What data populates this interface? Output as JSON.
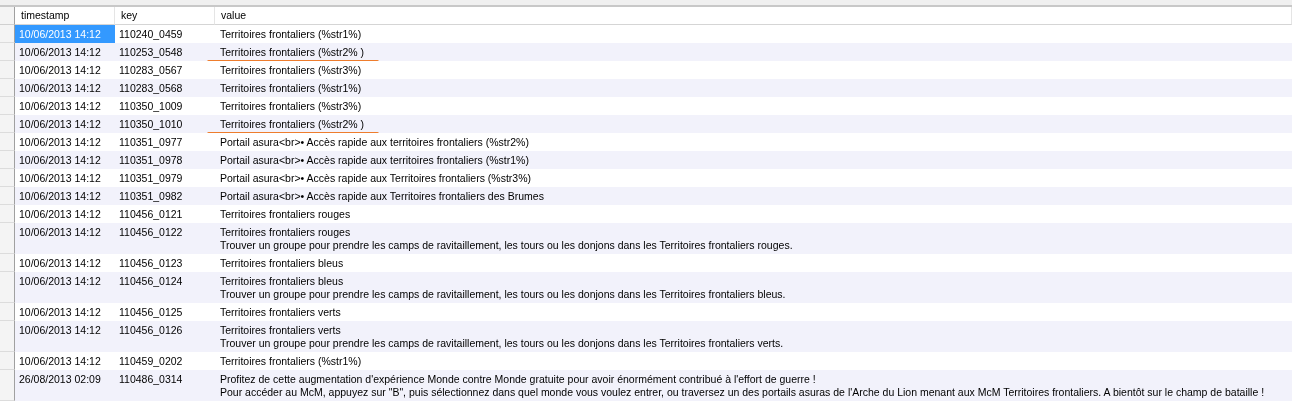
{
  "table": {
    "columns": [
      "timestamp",
      "key",
      "value"
    ],
    "rows": [
      {
        "timestamp": "10/06/2013 14:12",
        "key": "110240_0459",
        "value": [
          "Territoires frontaliers (%str1%)"
        ],
        "selected": true,
        "marked": false
      },
      {
        "timestamp": "10/06/2013 14:12",
        "key": "110253_0548",
        "value": [
          "Territoires frontaliers (%str2% )"
        ],
        "selected": false,
        "marked": true
      },
      {
        "timestamp": "10/06/2013 14:12",
        "key": "110283_0567",
        "value": [
          "Territoires frontaliers (%str3%)"
        ],
        "selected": false,
        "marked": false
      },
      {
        "timestamp": "10/06/2013 14:12",
        "key": "110283_0568",
        "value": [
          "Territoires frontaliers (%str1%)"
        ],
        "selected": false,
        "marked": false
      },
      {
        "timestamp": "10/06/2013 14:12",
        "key": "110350_1009",
        "value": [
          "Territoires frontaliers (%str3%)"
        ],
        "selected": false,
        "marked": false
      },
      {
        "timestamp": "10/06/2013 14:12",
        "key": "110350_1010",
        "value": [
          "Territoires frontaliers (%str2% )"
        ],
        "selected": false,
        "marked": true
      },
      {
        "timestamp": "10/06/2013 14:12",
        "key": "110351_0977",
        "value": [
          "Portail asura<br>• Accès rapide aux territoires frontaliers (%str2%)"
        ],
        "selected": false,
        "marked": false
      },
      {
        "timestamp": "10/06/2013 14:12",
        "key": "110351_0978",
        "value": [
          "Portail asura<br>• Accès rapide aux territoires frontaliers (%str1%)"
        ],
        "selected": false,
        "marked": false
      },
      {
        "timestamp": "10/06/2013 14:12",
        "key": "110351_0979",
        "value": [
          "Portail asura<br>• Accès rapide aux Territoires frontaliers (%str3%)"
        ],
        "selected": false,
        "marked": false
      },
      {
        "timestamp": "10/06/2013 14:12",
        "key": "110351_0982",
        "value": [
          "Portail asura<br>• Accès rapide aux Territoires frontaliers des Brumes"
        ],
        "selected": false,
        "marked": false
      },
      {
        "timestamp": "10/06/2013 14:12",
        "key": "110456_0121",
        "value": [
          "Territoires frontaliers rouges"
        ],
        "selected": false,
        "marked": false
      },
      {
        "timestamp": "10/06/2013 14:12",
        "key": "110456_0122",
        "value": [
          "Territoires frontaliers rouges",
          "Trouver un groupe pour prendre les camps de ravitaillement, les tours ou les donjons dans les Territoires frontaliers rouges."
        ],
        "selected": false,
        "marked": false
      },
      {
        "timestamp": "10/06/2013 14:12",
        "key": "110456_0123",
        "value": [
          "Territoires frontaliers bleus"
        ],
        "selected": false,
        "marked": false
      },
      {
        "timestamp": "10/06/2013 14:12",
        "key": "110456_0124",
        "value": [
          "Territoires frontaliers bleus",
          "Trouver un groupe pour prendre les camps de ravitaillement, les tours ou les donjons dans les Territoires frontaliers bleus."
        ],
        "selected": false,
        "marked": false
      },
      {
        "timestamp": "10/06/2013 14:12",
        "key": "110456_0125",
        "value": [
          "Territoires frontaliers verts"
        ],
        "selected": false,
        "marked": false
      },
      {
        "timestamp": "10/06/2013 14:12",
        "key": "110456_0126",
        "value": [
          "Territoires frontaliers verts",
          "Trouver un groupe pour prendre les camps de ravitaillement, les tours ou les donjons dans les Territoires frontaliers verts."
        ],
        "selected": false,
        "marked": false
      },
      {
        "timestamp": "10/06/2013 14:12",
        "key": "110459_0202",
        "value": [
          "Territoires frontaliers (%str1%)"
        ],
        "selected": false,
        "marked": false
      },
      {
        "timestamp": "26/08/2013 02:09",
        "key": "110486_0314",
        "value": [
          "Profitez de cette augmentation d'expérience Monde contre Monde gratuite pour avoir énormément contribué à l'effort de guerre !",
          "Pour accéder au McM, appuyez sur \"B\", puis sélectionnez dans quel monde vous voulez entrer, ou traversez un des portails asuras de l'Arche du Lion menant aux McM Territoires frontaliers. A bientôt sur le champ de bataille !"
        ],
        "selected": false,
        "marked": false
      }
    ]
  }
}
